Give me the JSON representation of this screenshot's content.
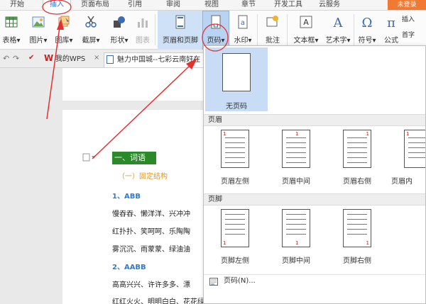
{
  "tabs": [
    {
      "label": "开始"
    },
    {
      "label": "插入"
    },
    {
      "label": "页面布局"
    },
    {
      "label": "引用"
    },
    {
      "label": "审阅"
    },
    {
      "label": "视图"
    },
    {
      "label": "章节"
    },
    {
      "label": "开发工具"
    },
    {
      "label": "云服务"
    }
  ],
  "login_label": "未登录",
  "ribbon": {
    "table": "表格▾",
    "picture": "图片▾",
    "gallery": "图库▾",
    "screenshot": "截屏▾",
    "shape": "形状▾",
    "chart": "图表",
    "header_footer": "页眉和页脚",
    "page_number": "页码▾",
    "watermark": "水印▾",
    "comment": "批注",
    "textbox": "文本框▾",
    "wordart": "艺术字▾",
    "symbol": "符号▾",
    "formula": "公式",
    "insert_small": "插入",
    "firstletter_small": "首字"
  },
  "docbar": {
    "mywps": "我的WPS",
    "doc_tab": "魅力中国城--七彩云南好在"
  },
  "doc": {
    "heading": "一、词语",
    "sub1": "（一）固定结构",
    "item1": "1、ABB",
    "line1": "慢吞吞、懒洋洋、兴冲冲",
    "line2": "红扑扑、笑呵呵、乐陶陶",
    "line3": "雾沉沉、雨蒙蒙、绿油油",
    "item2": "2、AABB",
    "line4": "高高兴兴、许许多多、漂",
    "line5": "红红火火、明明白白、花花绿绿、干干净净"
  },
  "dropdown": {
    "none_label": "无页码",
    "header_section": "页眉",
    "header_opts": [
      "页眉左侧",
      "页眉中间",
      "页眉右侧",
      "页眉内"
    ],
    "footer_section": "页脚",
    "footer_opts": [
      "页脚左侧",
      "页脚中间",
      "页脚右侧"
    ],
    "more_label": "页码(N)...",
    "thumb_num": "1"
  },
  "colors": {
    "accent": "#2e6fc4",
    "login": "#f07a34",
    "annotation": "#e53030",
    "heading_bg": "#2a8a2a"
  }
}
